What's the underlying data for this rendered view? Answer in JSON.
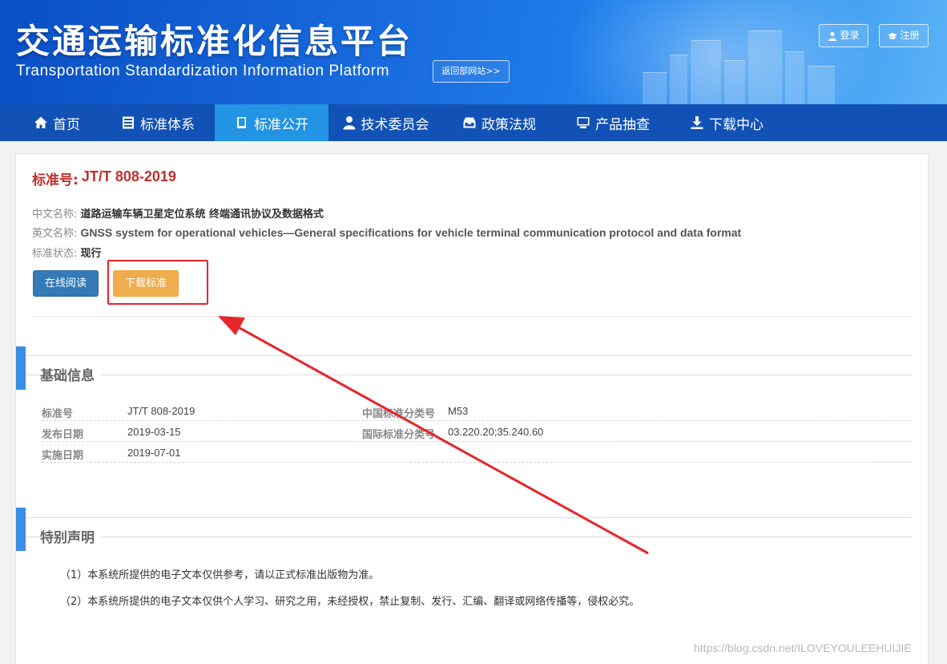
{
  "header": {
    "title": "交通运输标准化信息平台",
    "subtitle": "Transportation Standardization Information Platform",
    "back_button": "返回部网站>>",
    "login": "登录",
    "register": "注册"
  },
  "nav": {
    "items": [
      {
        "label": "首页",
        "icon": "home-icon"
      },
      {
        "label": "标准体系",
        "icon": "list-icon"
      },
      {
        "label": "标准公开",
        "icon": "book-icon",
        "active": true
      },
      {
        "label": "技术委员会",
        "icon": "user-icon"
      },
      {
        "label": "政策法规",
        "icon": "inbox-icon"
      },
      {
        "label": "产品抽查",
        "icon": "monitor-icon"
      },
      {
        "label": "下载中心",
        "icon": "download-icon"
      }
    ]
  },
  "standard": {
    "number_label": "标准号:",
    "number": "JT/T 808-2019",
    "cn_name_label": "中文名称:",
    "cn_name": "道路运输车辆卫星定位系统 终端通讯协议及数据格式",
    "en_name_label": "英文名称:",
    "en_name": "GNSS system for operational vehicles—General specifications for vehicle terminal communication protocol and data format",
    "status_label": "标准状态:",
    "status": "现行",
    "read_button": "在线阅读",
    "download_button": "下载标准"
  },
  "basic_info": {
    "title": "基础信息",
    "rows": [
      {
        "k1": "标准号",
        "v1": "JT/T 808-2019",
        "k2": "中国标准分类号",
        "v2": "M53"
      },
      {
        "k1": "发布日期",
        "v1": "2019-03-15",
        "k2": "国际标准分类号",
        "v2": "03.220.20;35.240.60"
      },
      {
        "k1": "实施日期",
        "v1": "2019-07-01",
        "k2": "",
        "v2": ""
      }
    ]
  },
  "notice": {
    "title": "特别声明",
    "items": [
      "（1）本系统所提供的电子文本仅供参考，请以正式标准出版物为准。",
      "（2）本系统所提供的电子文本仅供个人学习、研究之用，未经授权，禁止复制、发行、汇编、翻译或网络传播等，侵权必究。"
    ]
  },
  "watermark": "https://blog.csdn.net/ILOVEYOULEEHUIJIE",
  "colors": {
    "nav_bg": "#1252b6",
    "nav_active": "#2393e3",
    "title_red": "#c0302c",
    "primary": "#337ab7",
    "warning": "#f0ad4e",
    "annotation_red": "#e8252b"
  }
}
